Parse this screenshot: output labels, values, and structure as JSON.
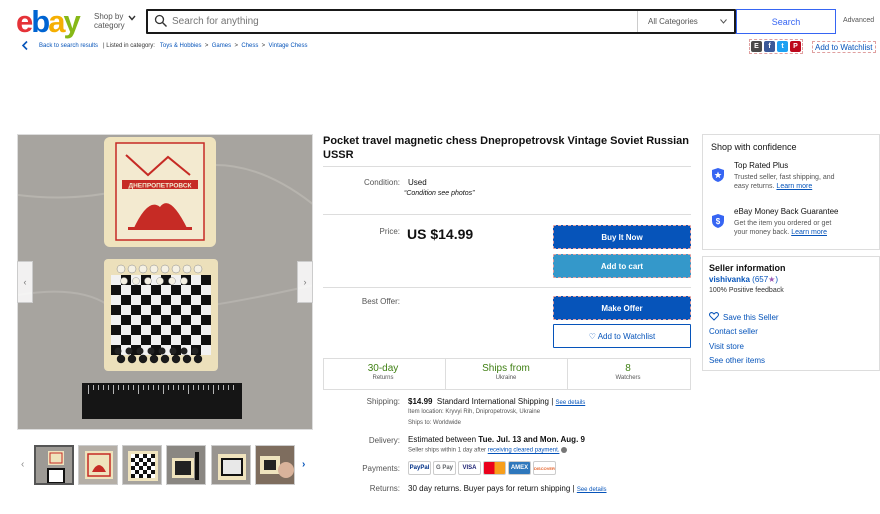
{
  "header": {
    "logo": [
      "e",
      "b",
      "a",
      "y"
    ],
    "shop_by": "Shop by",
    "category": "category",
    "search_placeholder": "Search for anything",
    "all_categories": "All Categories",
    "search_button": "Search",
    "advanced": "Advanced"
  },
  "breadcrumb": {
    "back": "Back to search results",
    "listed_in": "| Listed in category:",
    "items": [
      "Toys & Hobbies",
      "Games",
      "Chess",
      "Vintage Chess"
    ],
    "sep": ">"
  },
  "share": {
    "icons": [
      "E",
      "f",
      "t",
      "P"
    ],
    "colors": [
      "#4a4a4a",
      "#3b5998",
      "#1da1f2",
      "#bd081c"
    ],
    "watchlist": "Add to Watchlist"
  },
  "listing": {
    "title": "Pocket travel magnetic chess Dnepropetrovsk Vintage Soviet Russian USSR",
    "condition_label": "Condition:",
    "condition_value": "Used",
    "condition_note": "“Condition see photos”",
    "price_label": "Price:",
    "price": "US $14.99",
    "buy_now": "Buy It Now",
    "add_to_cart": "Add to cart",
    "best_offer_label": "Best Offer:",
    "make_offer": "Make Offer",
    "add_watchlist": "♡ Add to Watchlist",
    "stats": [
      {
        "n": "30-day",
        "t": "Returns"
      },
      {
        "n": "Ships from",
        "t": "Ukraine"
      },
      {
        "n": "8",
        "t": "Watchers"
      }
    ],
    "shipping_label": "Shipping:",
    "shipping_price": "$14.99",
    "shipping_method": "Standard International Shipping |",
    "see_details": "See details",
    "item_location": "Item location:  Kryvyi Rih, Dnipropetrovsk, Ukraine",
    "ships_to": "Ships to:   Worldwide",
    "delivery_label": "Delivery:",
    "delivery_pre": "Estimated between",
    "delivery_dates": "Tue. Jul. 13 and Mon. Aug. 9",
    "delivery_note": "Seller ships within 1 day after",
    "delivery_note_link": "receiving cleared payment.",
    "payments_label": "Payments:",
    "payments": [
      "PayPal",
      "G Pay",
      "VISA",
      "MC",
      "AMEX",
      "DISCOVER"
    ],
    "returns_label": "Returns:",
    "returns_text": "30 day returns. Buyer pays for return shipping |",
    "returns_link": "See details"
  },
  "confidence": {
    "title": "Shop with confidence",
    "trs_title": "Top Rated Plus",
    "trs_desc1": "Trusted seller, fast shipping, and",
    "trs_desc2": "easy returns.",
    "learn_more": "Learn more",
    "mbg_title": "eBay Money Back Guarantee",
    "mbg_desc1": "Get the item you ordered or get",
    "mbg_desc2": "your money back."
  },
  "seller": {
    "title": "Seller information",
    "name": "vishivanka",
    "score": "(657",
    "star": "★",
    "score_end": ")",
    "feedback": "100% Positive feedback",
    "save": "Save this Seller",
    "contact": "Contact seller",
    "store": "Visit store",
    "other": "See other items"
  },
  "gallery": {
    "prev": "‹",
    "next": "›",
    "left": "‹",
    "right": "›",
    "box_text": "ДНЕПРОПЕТРОВСК"
  },
  "colors": {
    "primary": "#0654ba",
    "buy": "#0654ba",
    "cart": "#3498ca",
    "green": "#408014"
  }
}
